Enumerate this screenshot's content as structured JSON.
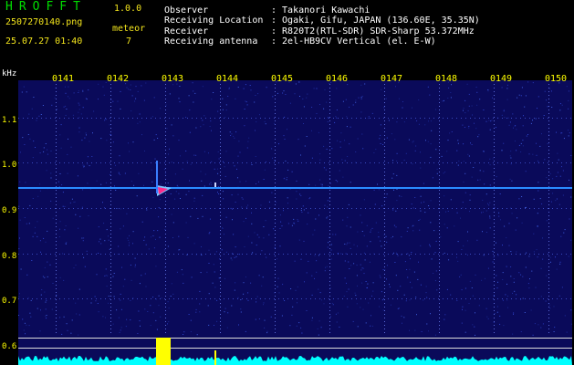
{
  "app": {
    "name": "HROFFT",
    "version": "1.0.0"
  },
  "file": {
    "name": "2507270140.png",
    "datetime": "25.07.27 01:40"
  },
  "detection": {
    "label": "meteor",
    "count": "7"
  },
  "info": [
    {
      "label": "Observer",
      "value": ": Takanori Kawachi"
    },
    {
      "label": "Receiving Location",
      "value": ": Ogaki, Gifu, JAPAN (136.60E, 35.35N)"
    },
    {
      "label": "Receiver",
      "value": ": R820T2(RTL-SDR) SDR-Sharp 53.372MHz"
    },
    {
      "label": "Receiving antenna",
      "value": ": 2el-HB9CV Vertical (el. E-W)"
    }
  ],
  "spectrogram": {
    "y_unit": "kHz",
    "y_ticks": [
      "1.1",
      "1.0",
      "0.9",
      "0.8",
      "0.7",
      "0.6"
    ],
    "time_ticks": [
      "0141",
      "0142",
      "0143",
      "0144",
      "0145",
      "0146",
      "0147",
      "0148",
      "0149",
      "0150"
    ],
    "colors": {
      "background": "#0a0a5a",
      "carrier": "#2a8cff",
      "meteor": "#ff2a8c",
      "power": "#00ffff",
      "event": "#ffff00"
    }
  }
}
